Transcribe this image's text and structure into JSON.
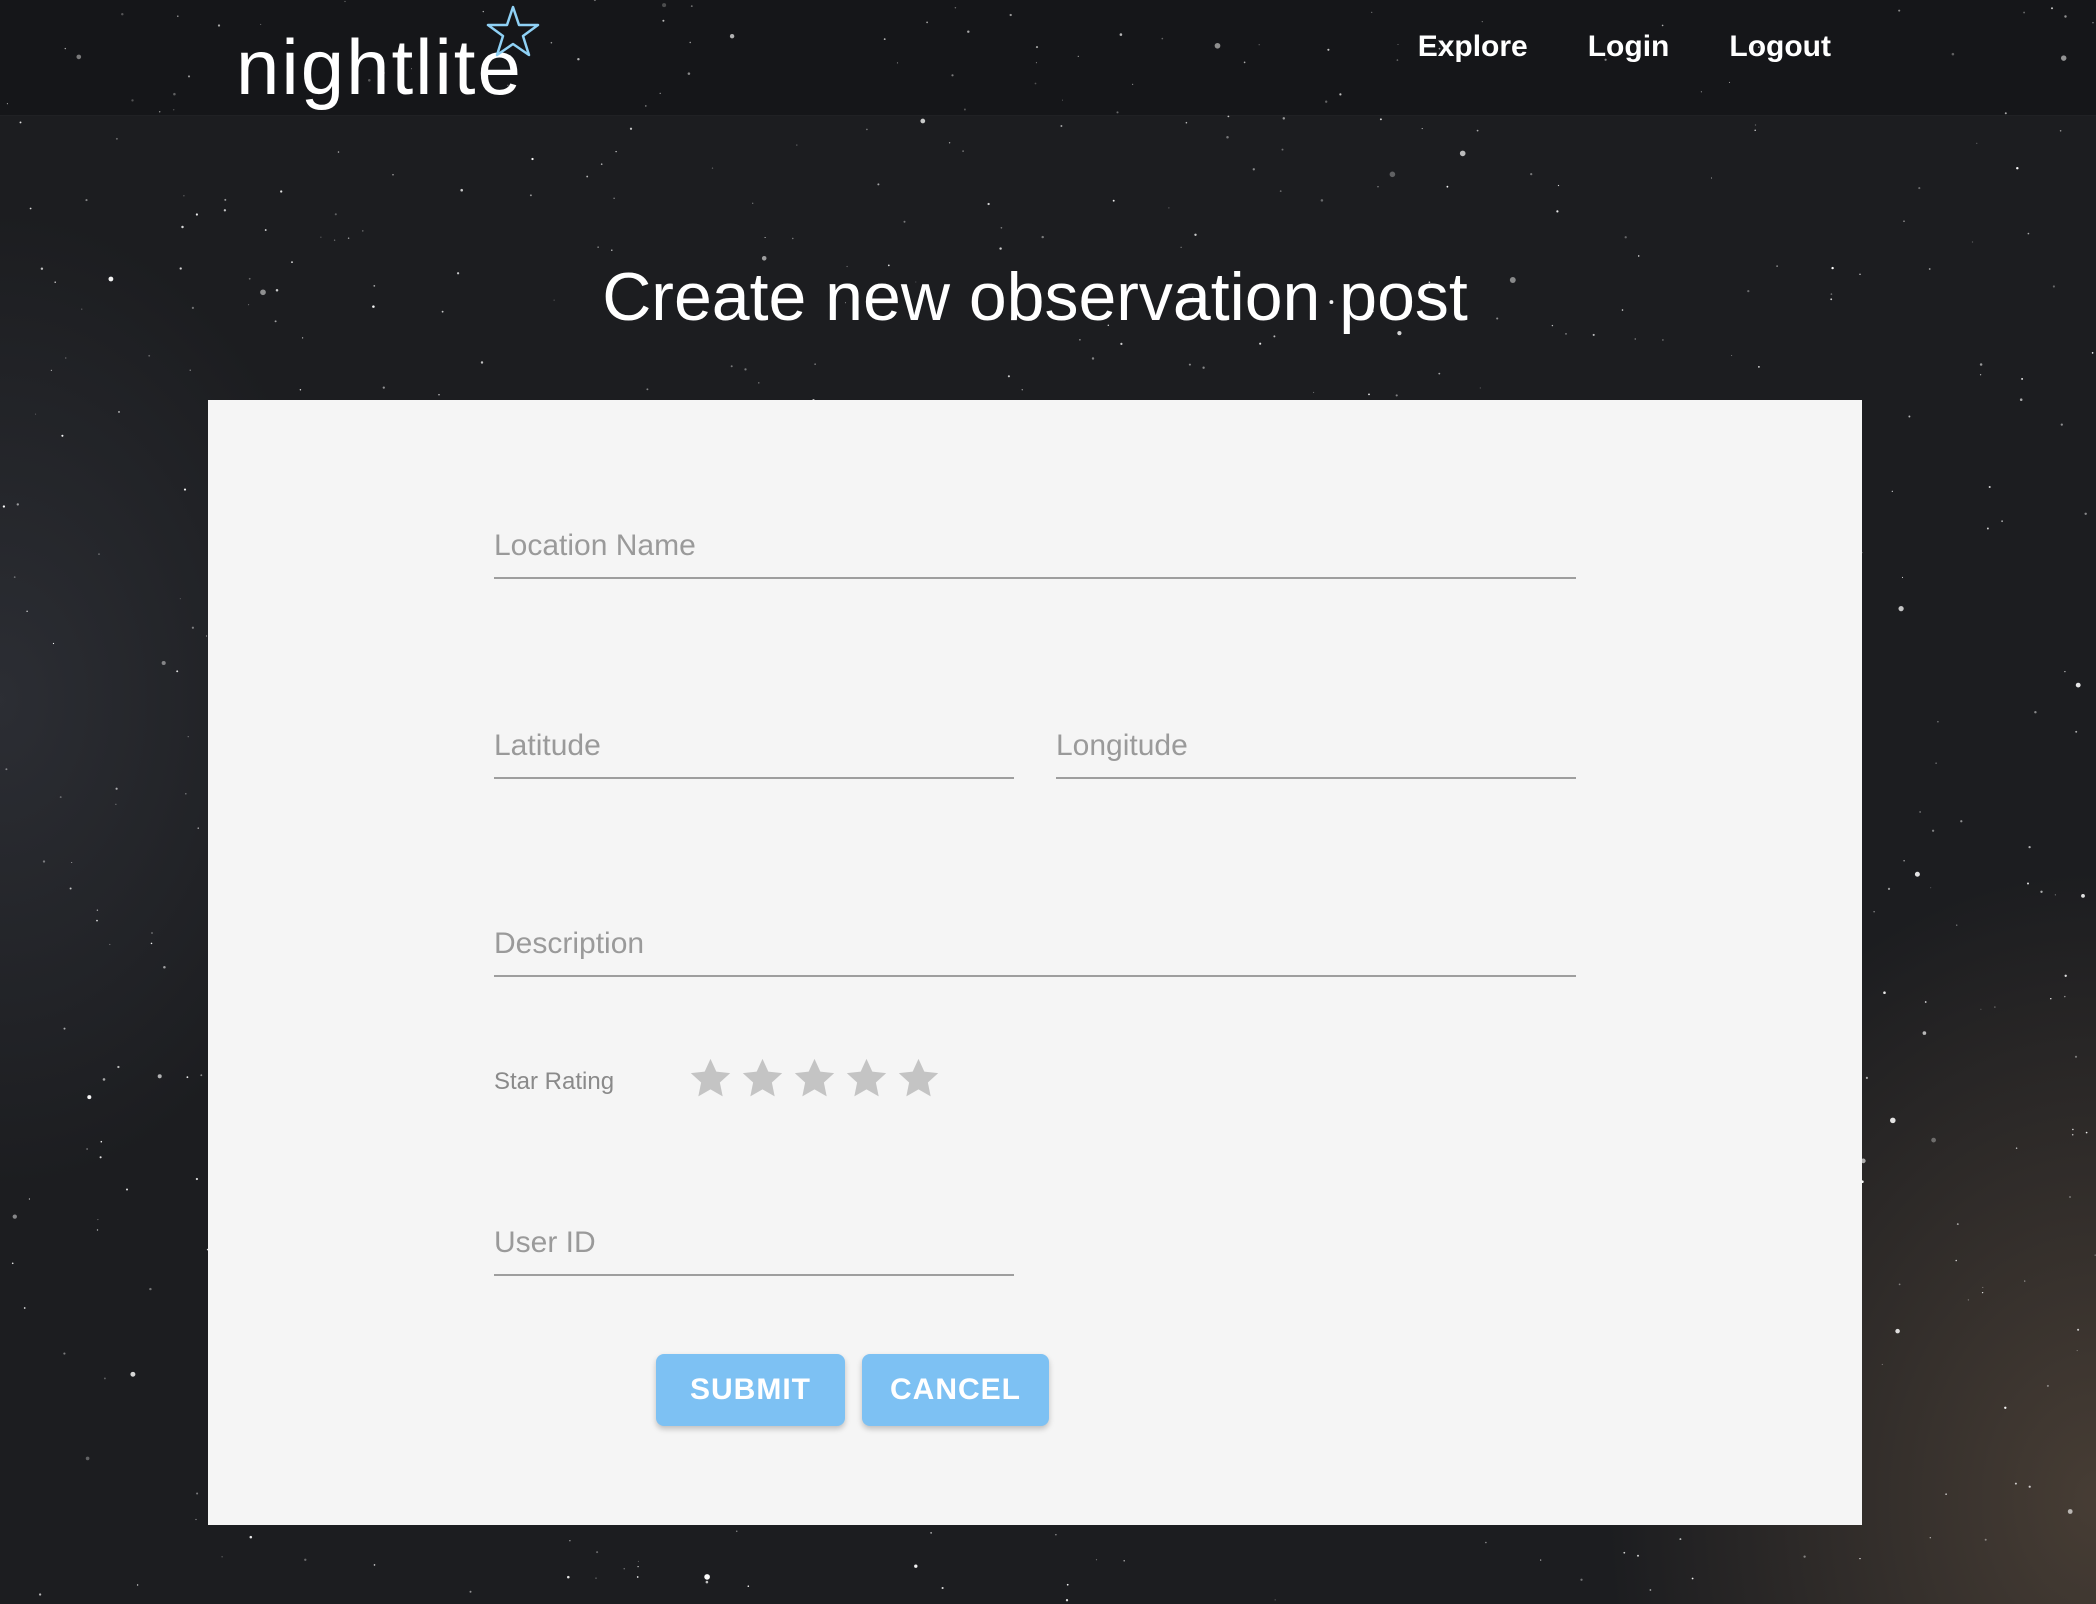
{
  "brand": {
    "logo_text": "nightlite",
    "accent_color": "#7dc1f3"
  },
  "nav": {
    "items": [
      {
        "label": "Explore"
      },
      {
        "label": "Login"
      },
      {
        "label": "Logout"
      }
    ]
  },
  "page": {
    "title": "Create new observation post"
  },
  "form": {
    "location_name": {
      "placeholder": "Location Name",
      "value": ""
    },
    "latitude": {
      "placeholder": "Latitude",
      "value": ""
    },
    "longitude": {
      "placeholder": "Longitude",
      "value": ""
    },
    "description": {
      "placeholder": "Description",
      "value": ""
    },
    "star_rating": {
      "label": "Star Rating",
      "max": 5,
      "value": 0,
      "icon": "star-icon"
    },
    "user_id": {
      "placeholder": "User ID",
      "value": ""
    },
    "submit_label": "SUBMIT",
    "cancel_label": "CANCEL"
  }
}
